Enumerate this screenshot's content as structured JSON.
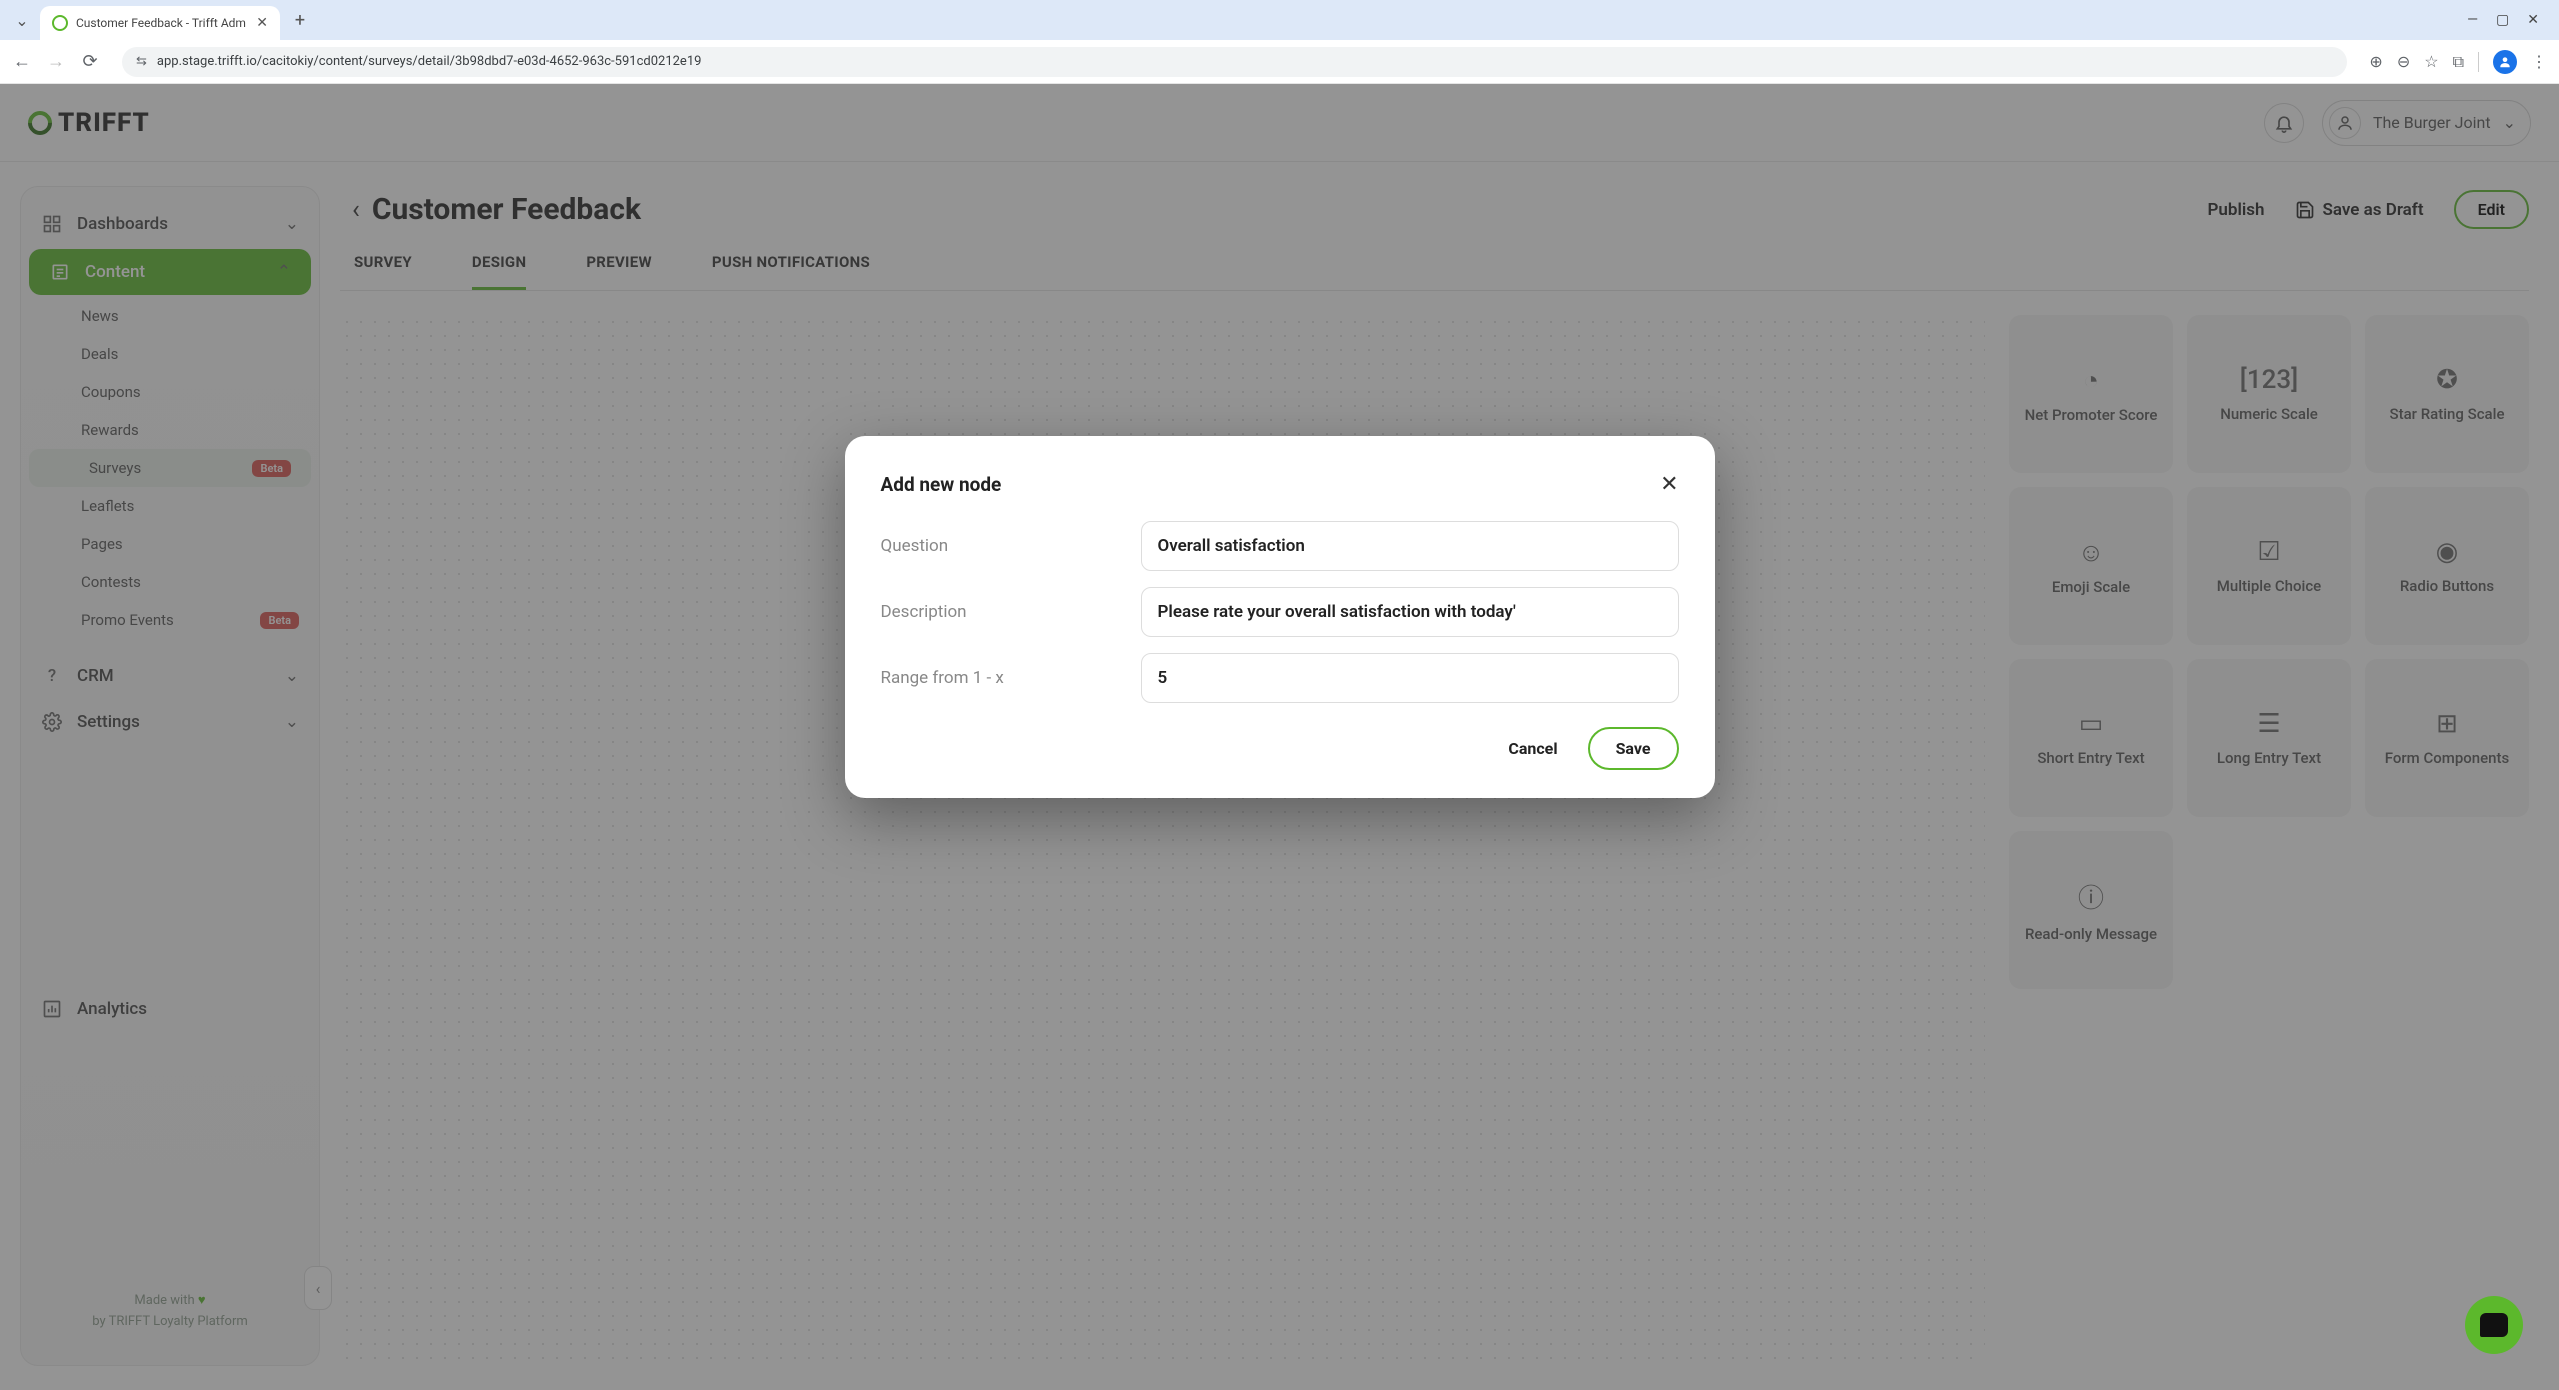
{
  "browser": {
    "tab_title": "Customer Feedback - Trifft Adm",
    "url": "app.stage.trifft.io/cacitokiy/content/surveys/detail/3b98dbd7-e03d-4652-963c-591cd0212e19"
  },
  "header": {
    "brand": "TRIFFT",
    "account": "The Burger Joint"
  },
  "sidebar": {
    "dashboards": "Dashboards",
    "content": "Content",
    "items": [
      {
        "label": "News"
      },
      {
        "label": "Deals"
      },
      {
        "label": "Coupons"
      },
      {
        "label": "Rewards"
      },
      {
        "label": "Surveys",
        "beta": true,
        "selected": true
      },
      {
        "label": "Leaflets"
      },
      {
        "label": "Pages"
      },
      {
        "label": "Contests"
      },
      {
        "label": "Promo Events",
        "beta": true
      }
    ],
    "crm": "CRM",
    "settings": "Settings",
    "analytics": "Analytics",
    "footer1": "Made with",
    "footer2": "by TRIFFT Loyalty Platform",
    "beta_badge": "Beta"
  },
  "page": {
    "title": "Customer Feedback",
    "actions": {
      "publish": "Publish",
      "save_draft": "Save as Draft",
      "edit": "Edit"
    },
    "tabs": [
      "SURVEY",
      "DESIGN",
      "PREVIEW",
      "PUSH NOTIFICATIONS"
    ],
    "active_tab": "DESIGN"
  },
  "palette": [
    "Net Promoter Score",
    "Numeric Scale",
    "Star Rating Scale",
    "Emoji Scale",
    "Multiple Choice",
    "Radio Buttons",
    "Short Entry Text",
    "Long Entry Text",
    "Form Components",
    "Read-only Message"
  ],
  "modal": {
    "title": "Add new node",
    "fields": {
      "question_label": "Question",
      "question_value": "Overall satisfaction",
      "description_label": "Description",
      "description_value": "Please rate your overall satisfaction with today'",
      "range_label": "Range from 1 - x",
      "range_value": "5"
    },
    "cancel": "Cancel",
    "save": "Save"
  }
}
